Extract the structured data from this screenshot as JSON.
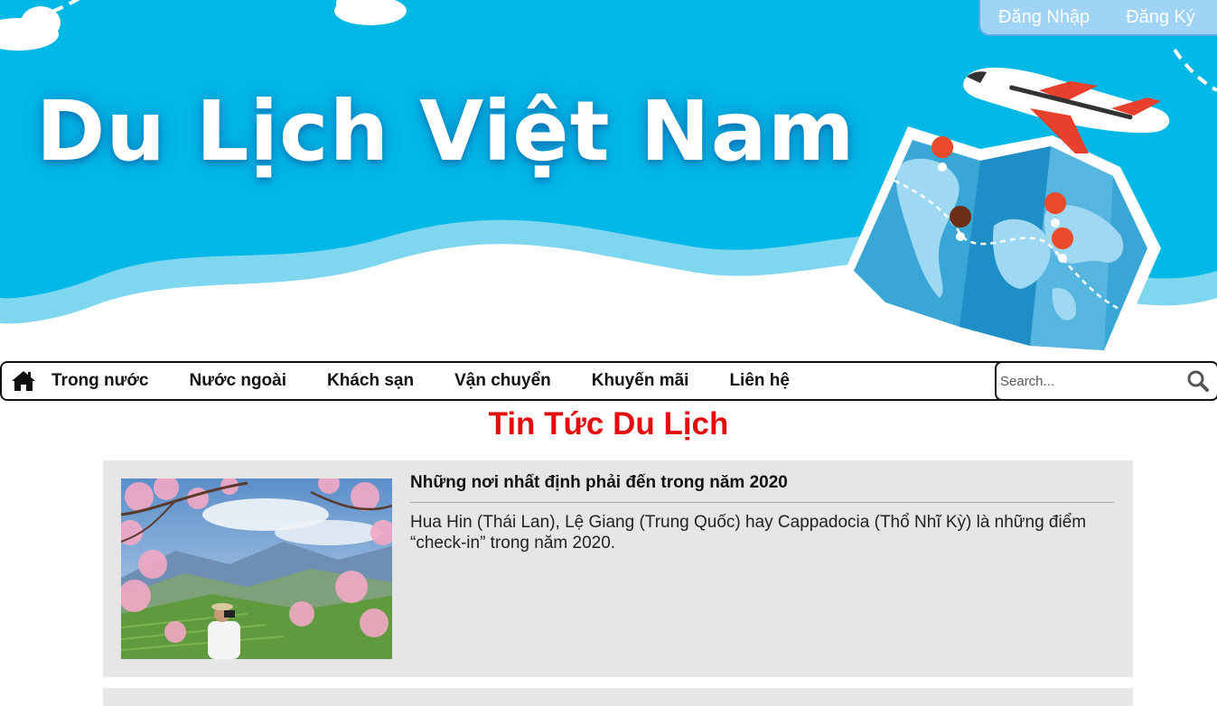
{
  "banner": {
    "title": "Du Lịch Việt Nam",
    "sky_color": "#00b8e6",
    "auth": {
      "login_label": "Đăng Nhập",
      "register_label": "Đăng Ký"
    }
  },
  "nav": {
    "home_icon": "home-icon",
    "items": [
      {
        "label": "Trong nước"
      },
      {
        "label": "Nước ngoài"
      },
      {
        "label": "Khách sạn"
      },
      {
        "label": "Vận chuyển"
      },
      {
        "label": "Khuyến mãi"
      },
      {
        "label": "Liên hệ"
      }
    ],
    "search": {
      "placeholder": "Search...",
      "value": "",
      "icon": "search-icon"
    }
  },
  "main": {
    "section_title": "Tin Tức Du Lịch",
    "title_color": "#e30d0d",
    "news": [
      {
        "headline": "Những nơi nhất định phải đến trong năm 2020",
        "summary": "Hua Hin (Thái Lan), Lệ Giang (Trung Quốc) hay Cappadocia (Thổ Nhĩ Kỳ) là những điểm “check-in” trong năm 2020."
      }
    ]
  }
}
